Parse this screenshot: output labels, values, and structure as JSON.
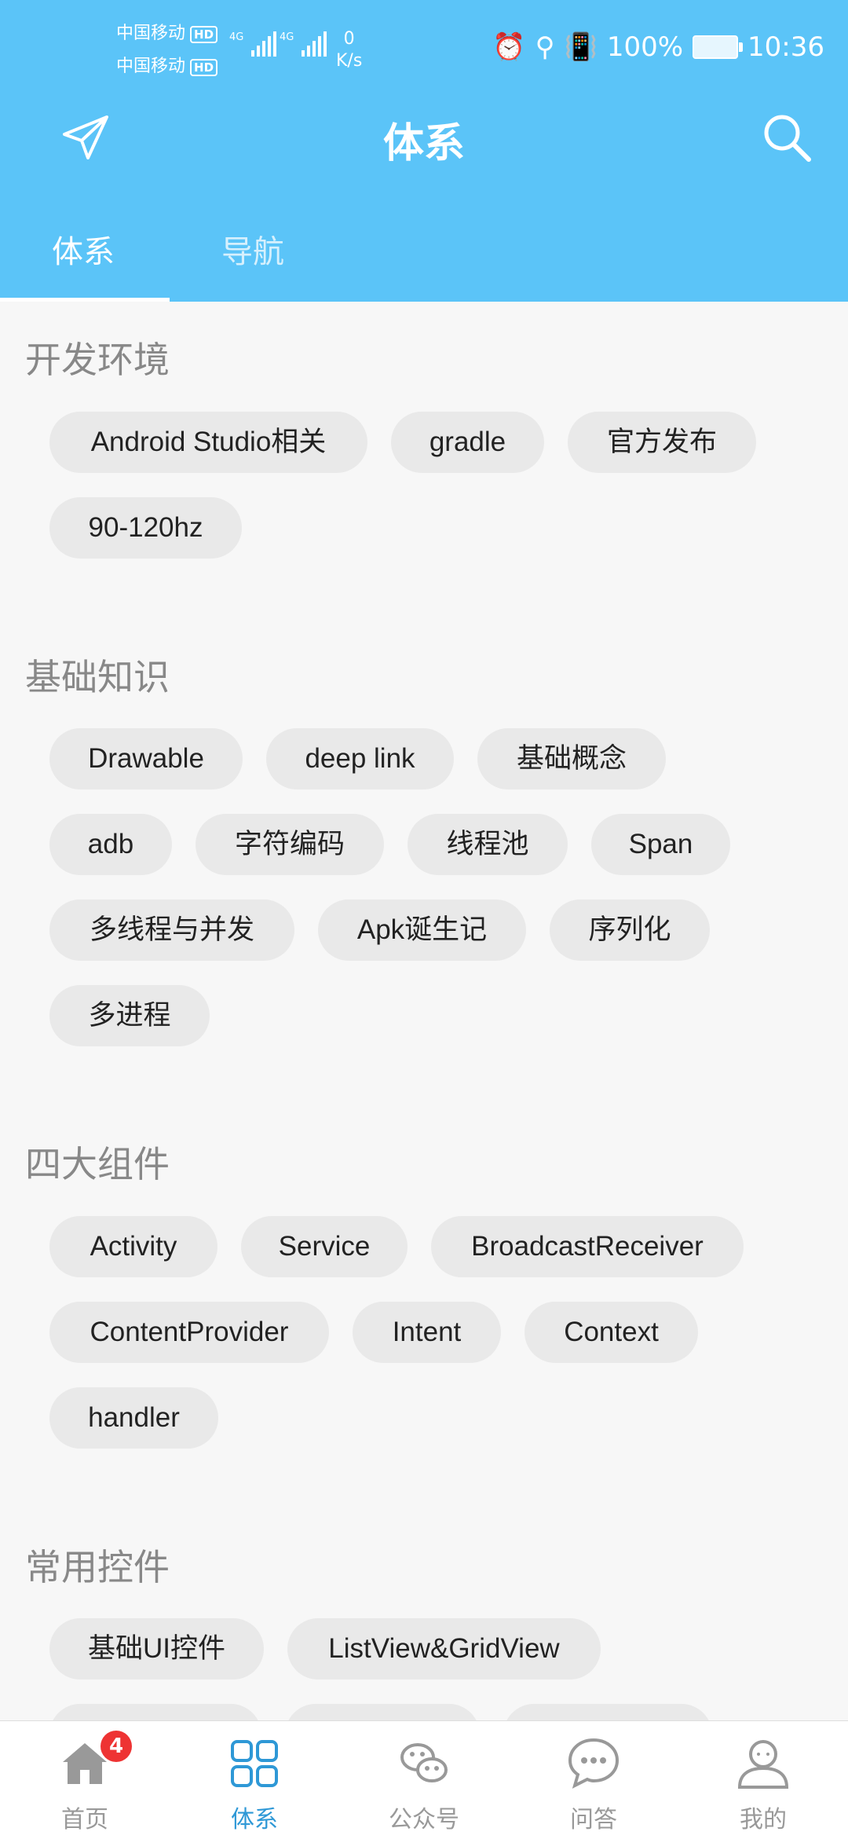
{
  "status_bar": {
    "carrier1": "中国移动",
    "carrier2": "中国移动",
    "hd": "HD",
    "net1": "4G",
    "net2": "4G",
    "speed_value": "0",
    "speed_unit": "K/s",
    "battery": "100%",
    "time": "10:36"
  },
  "toolbar": {
    "title": "体系"
  },
  "tabs": [
    {
      "label": "体系"
    },
    {
      "label": "导航"
    }
  ],
  "sections": [
    {
      "title": "开发环境",
      "chips": [
        "Android Studio相关",
        "gradle",
        "官方发布",
        "90-120hz"
      ]
    },
    {
      "title": "基础知识",
      "chips": [
        "Drawable",
        "deep link",
        "基础概念",
        "adb",
        "字符编码",
        "线程池",
        "Span",
        "多线程与并发",
        "Apk诞生记",
        "序列化",
        "多进程"
      ]
    },
    {
      "title": "四大组件",
      "chips": [
        "Activity",
        "Service",
        "BroadcastReceiver",
        "ContentProvider",
        "Intent",
        "Context",
        "handler"
      ]
    },
    {
      "title": "常用控件",
      "chips": [
        "基础UI控件",
        "ListView&GridView"
      ]
    }
  ],
  "bottom_nav": [
    {
      "label": "首页",
      "icon": "home-icon",
      "badge": "4"
    },
    {
      "label": "体系",
      "icon": "grid-icon"
    },
    {
      "label": "公众号",
      "icon": "wechat-icon"
    },
    {
      "label": "问答",
      "icon": "chat-bubble-icon"
    },
    {
      "label": "我的",
      "icon": "person-icon"
    }
  ],
  "colors": {
    "header": "#5bc4f8",
    "active": "#2e98d6",
    "badge": "#e33333",
    "chip": "#e9e9e9"
  }
}
